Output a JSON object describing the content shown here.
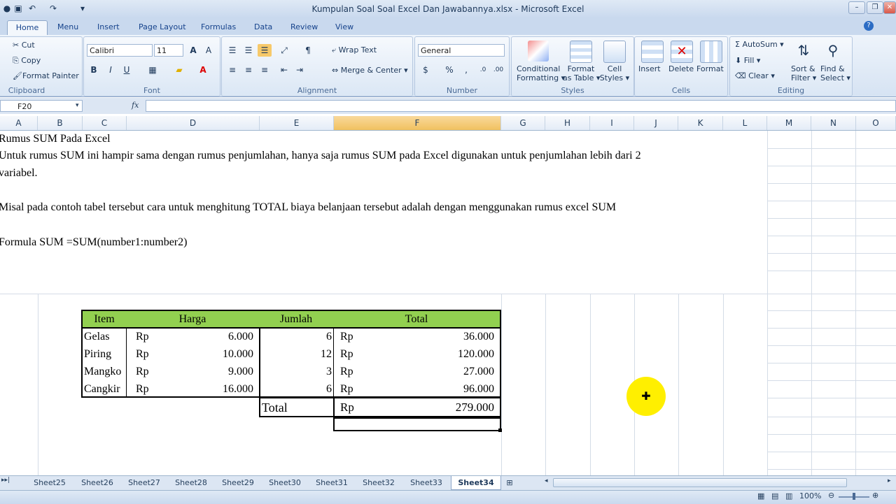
{
  "window": {
    "title": "Kumpulan Soal Soal Excel Dan Jawabannya.xlsx - Microsoft Excel"
  },
  "ribbon_tabs": [
    "Home",
    "Menu",
    "Insert",
    "Page Layout",
    "Formulas",
    "Data",
    "Review",
    "View"
  ],
  "ribbon": {
    "clipboard": {
      "cut": "Cut",
      "copy": "Copy",
      "format_painter": "Format Painter",
      "label": "Clipboard"
    },
    "font": {
      "name": "Calibri",
      "size": "11",
      "label": "Font"
    },
    "alignment": {
      "wrap_text": "Wrap Text",
      "merge_center": "Merge & Center",
      "label": "Alignment"
    },
    "number": {
      "format": "General",
      "label": "Number"
    },
    "styles": {
      "conditional": "Conditional",
      "formatting": "Formatting",
      "format_as": "Format",
      "as_table": "as Table",
      "cell": "Cell",
      "cell_styles": "Styles",
      "label": "Styles"
    },
    "cells": {
      "insert": "Insert",
      "delete": "Delete",
      "format": "Format",
      "label": "Cells"
    },
    "editing": {
      "autosum": "AutoSum",
      "fill": "Fill",
      "clear": "Clear",
      "sort": "Sort &",
      "filter": "Filter",
      "find": "Find &",
      "select": "Select",
      "label": "Editing"
    }
  },
  "formula_bar": {
    "name_box": "F20",
    "fx": "fx",
    "value": ""
  },
  "columns": [
    "A",
    "B",
    "C",
    "D",
    "E",
    "F",
    "G",
    "H",
    "I",
    "J",
    "K",
    "L",
    "M",
    "N",
    "O"
  ],
  "selected_column": "F",
  "text_lines": [
    "Rumus SUM Pada Excel",
    "Untuk rumus SUM ini hampir sama dengan rumus penjumlahan, hanya saja rumus SUM pada Excel digunakan untuk penjumlahan lebih dari 2",
    "variabel.",
    "Misal pada contoh tabel tersebut cara untuk menghitung TOTAL biaya belanjaan tersebut adalah dengan menggunakan rumus excel SUM",
    "Formula SUM =SUM(number1:number2)"
  ],
  "table": {
    "headers": {
      "item": "Item",
      "harga": "Harga",
      "jumlah": "Jumlah",
      "total": "Total"
    },
    "currency": "Rp",
    "rows": [
      {
        "item": "Gelas",
        "harga": "6.000",
        "jumlah": "6",
        "total": "36.000"
      },
      {
        "item": "Piring",
        "harga": "10.000",
        "jumlah": "12",
        "total": "120.000"
      },
      {
        "item": "Mangko",
        "harga": "9.000",
        "jumlah": "3",
        "total": "27.000"
      },
      {
        "item": "Cangkir",
        "harga": "16.000",
        "jumlah": "6",
        "total": "96.000"
      }
    ],
    "total_label": "Total",
    "grand_total": "279.000",
    "header_color": "#92d050"
  },
  "sheet_tabs": [
    "Sheet25",
    "Sheet26",
    "Sheet27",
    "Sheet28",
    "Sheet29",
    "Sheet30",
    "Sheet31",
    "Sheet32",
    "Sheet33",
    "Sheet34"
  ],
  "active_sheet": "Sheet34",
  "status": {
    "zoom": "100%"
  }
}
